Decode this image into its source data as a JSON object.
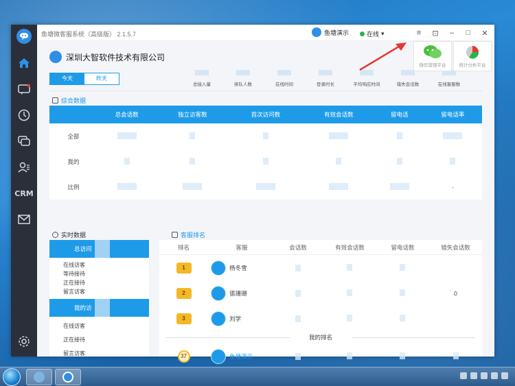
{
  "window": {
    "title": "鱼塘微客服系统（高级版） 2.1.5.7",
    "user_name": "鱼塘演示",
    "status": "在线"
  },
  "sidebar": {
    "items": [
      "home-icon",
      "chat-icon",
      "history-icon",
      "message-icon",
      "contacts-icon",
      "CRM",
      "mail-icon",
      "settings-icon"
    ],
    "crm_label": "CRM"
  },
  "header": {
    "company": "深圳大智软件技术有限公司",
    "tabs": [
      {
        "label": "今天",
        "active": true
      },
      {
        "label": "昨天",
        "active": false
      }
    ],
    "metrics": [
      "总接入量",
      "排队人数",
      "在线时间",
      "登录时长",
      "平均响应时间",
      "错失会话数",
      "在线客服数"
    ],
    "promo": [
      {
        "label": "微信营销平台",
        "icon": "wechat-icon"
      },
      {
        "label": "统计分析平台",
        "icon": "pie-chart-icon"
      }
    ]
  },
  "summary": {
    "title": "综合数据",
    "columns": [
      "",
      "总会话数",
      "独立访客数",
      "首次访问数",
      "有效会话数",
      "留电话",
      "留电话率"
    ],
    "rows": [
      {
        "label": "全部"
      },
      {
        "label": "我的"
      },
      {
        "label": "比例",
        "last": "-"
      }
    ]
  },
  "realtime": {
    "title": "实时数据",
    "group1_label": "总访问",
    "group1_rows": [
      "在线访客",
      "等待接待",
      "正在接待",
      "留言访客"
    ],
    "group2_label": "我的访",
    "group2_rows": [
      "在线访客",
      "正在接待",
      "留言访客"
    ]
  },
  "ranking": {
    "title": "客服排名",
    "columns": [
      "排名",
      "客服",
      "会话数",
      "有效会话数",
      "留电话数",
      "错失会话数"
    ],
    "rows": [
      {
        "rank": "1",
        "name": "杨冬雪",
        "missed": ""
      },
      {
        "rank": "2",
        "name": "張珊珊",
        "missed": "0"
      },
      {
        "rank": "3",
        "name": "刘学",
        "missed": ""
      }
    ],
    "my_rank_label": "我的排名",
    "my_row": {
      "rank": "37",
      "name": "鱼塘演示"
    }
  },
  "colors": {
    "accent": "#1e9be8",
    "sidebar": "#2b2f3a",
    "medal": "#f4b728",
    "arrow": "#e53935"
  }
}
